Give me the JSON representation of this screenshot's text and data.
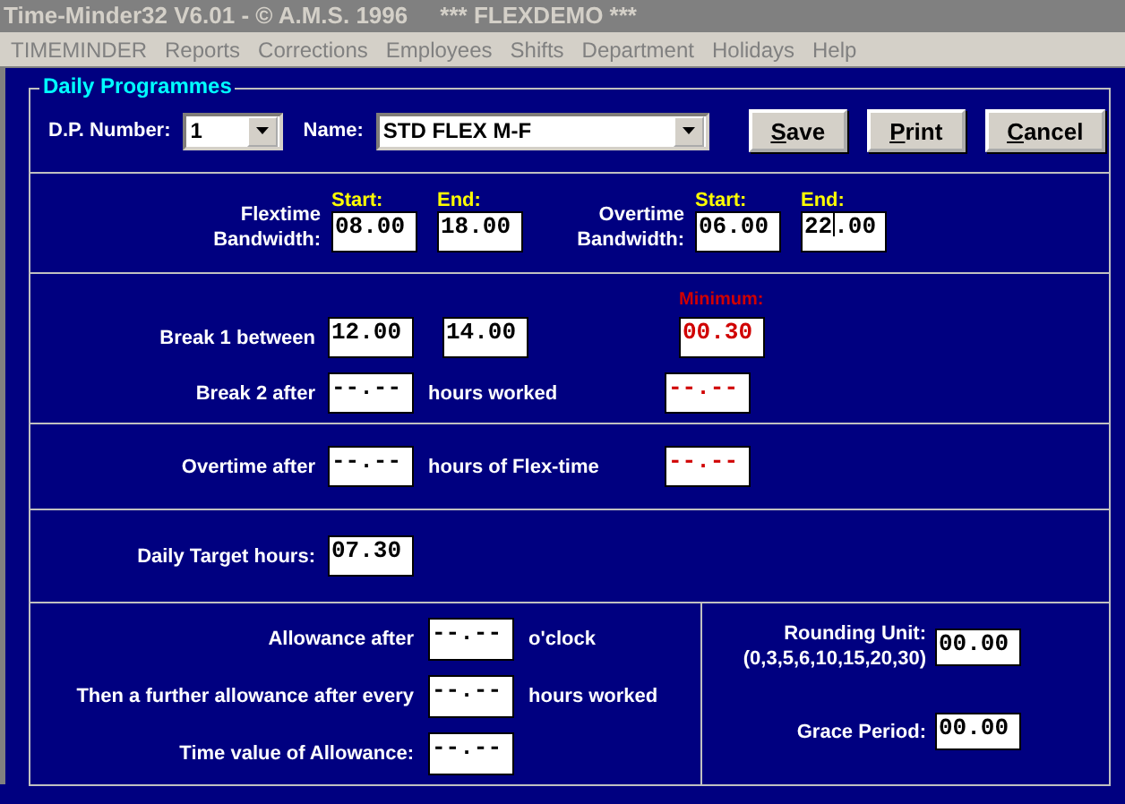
{
  "window": {
    "title": "Time-Minder32 V6.01 - © A.M.S. 1996     *** FLEXDEMO ***"
  },
  "menu": [
    {
      "label": "TIMEMINDER"
    },
    {
      "label": "Reports"
    },
    {
      "label": "Corrections"
    },
    {
      "label": "Employees"
    },
    {
      "label": "Shifts"
    },
    {
      "label": "Department"
    },
    {
      "label": "Holidays"
    },
    {
      "label": "Help"
    }
  ],
  "group": {
    "title": "Daily Programmes"
  },
  "dp_number": {
    "label": "D.P. Number:",
    "value": "1"
  },
  "name": {
    "label": "Name:",
    "value": "STD FLEX M-F"
  },
  "buttons": [
    {
      "mnemonic": "S",
      "rest": "ave"
    },
    {
      "mnemonic": "P",
      "rest": "rint"
    },
    {
      "mnemonic": "C",
      "rest": "ancel"
    }
  ],
  "bandwidths": [
    {
      "label": "Flextime\nBandwidth:",
      "start_label": "Start:",
      "end_label": "End:",
      "start": {
        "value": "08.00"
      },
      "end": {
        "value": "18.00"
      }
    },
    {
      "label": "Overtime\nBandwidth:",
      "start_label": "Start:",
      "end_label": "End:",
      "start": {
        "value": "06.00"
      },
      "end": {
        "before_caret": "22",
        "after_caret": ".00"
      }
    }
  ],
  "breaks": {
    "minimum_label": "Minimum:",
    "break_1": {
      "label": "Break 1 between",
      "from": "12.00",
      "to": "14.00",
      "minimum": "00.30"
    },
    "break_2": {
      "label": "Break 2 after",
      "value": "--.--",
      "suffix": "hours worked",
      "minimum": "--.--"
    }
  },
  "overtime": {
    "label": "Overtime after",
    "value": "--.--",
    "suffix": "hours of Flex-time",
    "minimum": "--.--"
  },
  "daily_target": {
    "label": "Daily Target hours:",
    "value": "07.30"
  },
  "allowances": [
    {
      "label": "Allowance after",
      "value": "--.--",
      "suffix": "o'clock"
    },
    {
      "label": "Then a further allowance after every",
      "value": "--.--",
      "suffix": "hours worked"
    },
    {
      "label": "Time value of Allowance:",
      "value": "--.--"
    }
  ],
  "rounding": {
    "label": "Rounding Unit:\n(0,3,5,6,10,15,20,30)",
    "value": "00.00"
  },
  "grace": {
    "label": "Grace Period:",
    "value": "00.00"
  }
}
